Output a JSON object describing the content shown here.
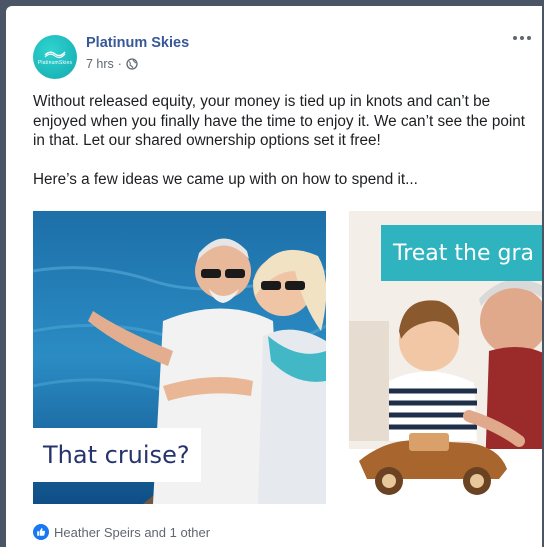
{
  "post": {
    "page_name": "Platinum Skies",
    "avatar_text": "PlatinumSkies",
    "time": "7 hrs",
    "separator": "·",
    "privacy_icon": "globe-icon",
    "more_icon": "more-options-icon",
    "paragraphs": [
      "Without released equity, your money is tied up in knots and can’t be enjoyed when you finally have the time to enjoy it. We can’t see the point in that. Let our shared ownership options set it free!",
      "Here’s a few ideas we came up with on how to spend it..."
    ]
  },
  "carousel": {
    "cards": [
      {
        "caption": "That cruise?"
      },
      {
        "caption": "Treat the gra"
      }
    ]
  },
  "reactions": {
    "icon": "like-icon",
    "summary": "Heather Speirs and 1 other"
  },
  "colors": {
    "page_name": "#385898",
    "brand_teal": "#2fb3be",
    "caption_text": "#26346e",
    "like_blue": "#1877f2"
  }
}
